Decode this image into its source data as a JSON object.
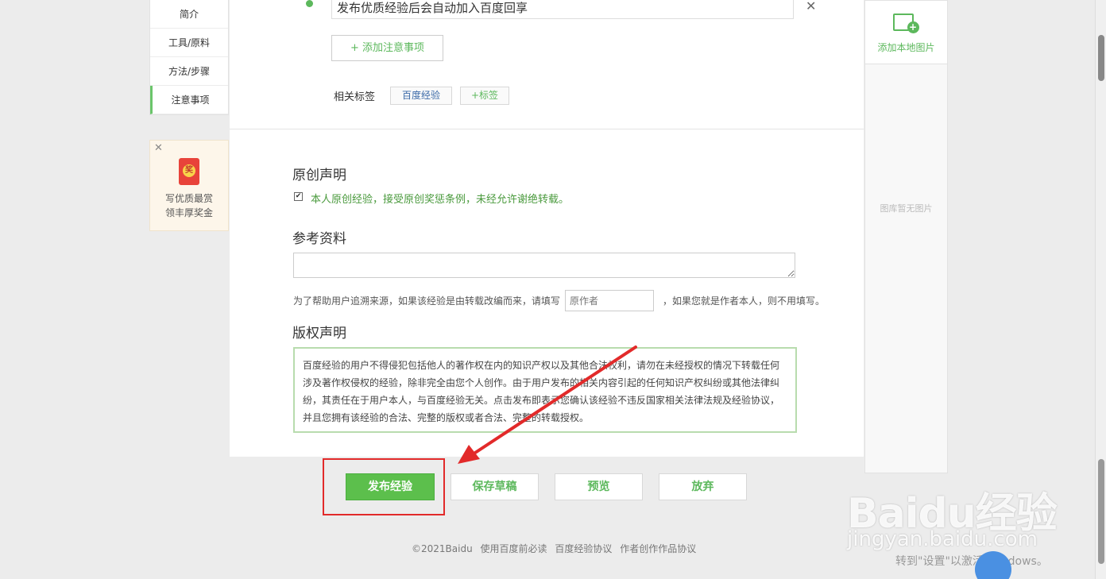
{
  "left_nav": {
    "items": [
      {
        "label": "简介"
      },
      {
        "label": "工具/原料"
      },
      {
        "label": "方法/步骤"
      },
      {
        "label": "注意事项"
      }
    ]
  },
  "promo": {
    "badge": "奖",
    "line1": "写优质最赏",
    "line2": "领丰厚奖金"
  },
  "notes": {
    "item_value": "发布优质经验后会自动加入百度回享",
    "add_button": "+ 添加注意事项"
  },
  "tags": {
    "label": "相关标签",
    "items": [
      "百度经验"
    ],
    "add_label": "+标签"
  },
  "original": {
    "title": "原创声明",
    "checked": true,
    "text": "本人原创经验，接受原创奖惩条例，未经允许谢绝转载。"
  },
  "reference": {
    "title": "参考资料",
    "hint_prefix": "为了帮助用户追溯来源，如果该经验是由转载改编而来，请填写",
    "author_placeholder": "原作者",
    "hint_suffix": "，如果您就是作者本人，则不用填写。"
  },
  "copyright": {
    "title": "版权声明",
    "text": "百度经验的用户不得侵犯包括他人的著作权在内的知识产权以及其他合法权利，请勿在未经授权的情况下转载任何涉及著作权侵权的经验，除非完全由您个人创作。由于用户发布的相关内容引起的任何知识产权纠纷或其他法律纠纷，其责任在于用户本人，与百度经验无关。点击发布即表示您确认该经验不违反国家相关法律法规及经验协议，并且您拥有该经验的合法、完整的版权或者合法、完整的转载授权。"
  },
  "right_panel": {
    "add_image_label": "添加本地图片",
    "empty_text": "图库暂无图片"
  },
  "actions": {
    "publish": "发布经验",
    "save_draft": "保存草稿",
    "preview": "预览",
    "discard": "放弃"
  },
  "footer": {
    "copyright": "©2021Baidu",
    "links": [
      "使用百度前必读",
      "百度经验协议",
      "作者创作作品协议"
    ]
  },
  "watermark": {
    "brand": "Baidu经验",
    "url": "jingyan.baidu.com"
  },
  "system": {
    "activate_text": "转到\"设置\"以激活 Windows。"
  },
  "colors": {
    "accent": "#5cb85c",
    "highlight": "#e22a2a"
  }
}
